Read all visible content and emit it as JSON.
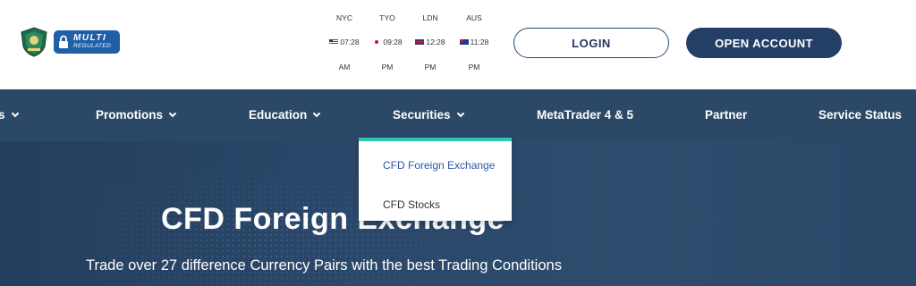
{
  "header": {
    "badge": {
      "line1": "MULTI",
      "line2": "REGULATED"
    },
    "clocks": [
      {
        "city": "NYC",
        "flag": "us-flag-icon",
        "time": "07:28",
        "ampm": "AM"
      },
      {
        "city": "TYO",
        "flag": "jp-flag-icon",
        "time": "09:28",
        "ampm": "PM"
      },
      {
        "city": "LDN",
        "flag": "uk-flag-icon",
        "time": "12:28",
        "ampm": "PM"
      },
      {
        "city": "AUS",
        "flag": "au-flag-icon",
        "time": "11:28",
        "ampm": "PM"
      }
    ],
    "login_label": "LOGIN",
    "open_account_label": "OPEN ACCOUNT"
  },
  "nav": {
    "items": [
      {
        "label": "s",
        "has_dropdown": true
      },
      {
        "label": "Promotions",
        "has_dropdown": true
      },
      {
        "label": "Education",
        "has_dropdown": true
      },
      {
        "label": "Securities",
        "has_dropdown": true
      },
      {
        "label": "MetaTrader 4 & 5",
        "has_dropdown": false
      },
      {
        "label": "Partner",
        "has_dropdown": false
      },
      {
        "label": "Service Status",
        "has_dropdown": false
      }
    ],
    "dropdown": {
      "items": [
        {
          "label": "CFD Foreign Exchange",
          "active": true
        },
        {
          "label": "CFD Stocks",
          "active": false
        }
      ]
    }
  },
  "hero": {
    "title": "CFD Foreign Exchange",
    "subtitle": "Trade over 27 difference Currency Pairs with the best Trading Conditions"
  },
  "colors": {
    "nav_bg": "#2b4867",
    "accent_teal": "#2ec4b6",
    "button_dark": "#243f66",
    "link_blue": "#2b5aa0"
  }
}
